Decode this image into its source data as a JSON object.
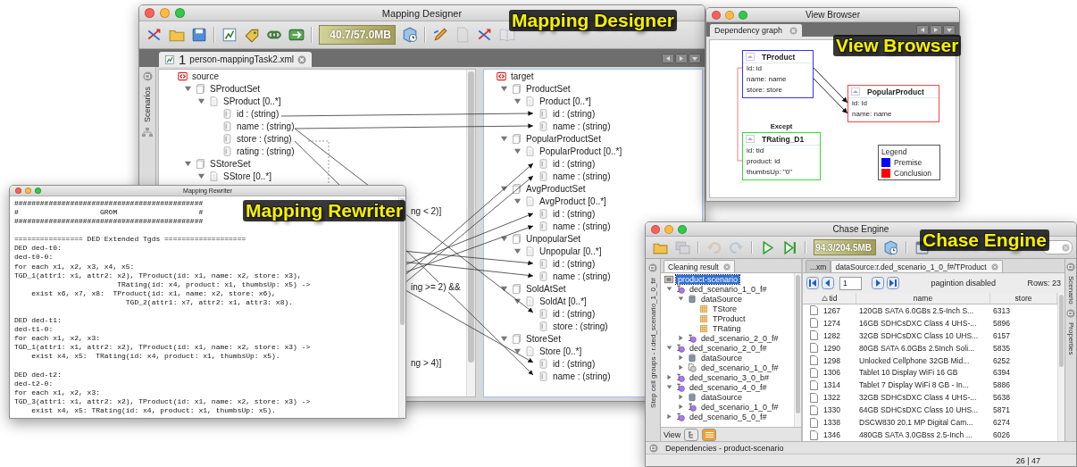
{
  "mapping_designer": {
    "title": "Mapping Designer",
    "callout": "Mapping Designer",
    "toolbar": [
      {
        "kind": "arrows",
        "disabled": false
      },
      {
        "kind": "folder",
        "disabled": false
      },
      {
        "kind": "disk",
        "disabled": false
      },
      {
        "kind": "separator"
      },
      {
        "kind": "chart",
        "disabled": false
      },
      {
        "kind": "tag",
        "disabled": false
      },
      {
        "kind": "chain",
        "disabled": false
      },
      {
        "kind": "refresh",
        "disabled": false
      },
      {
        "kind": "separator"
      },
      {
        "kind": "memory",
        "text": "40.7/57.0MB"
      },
      {
        "kind": "gc",
        "disabled": false
      },
      {
        "kind": "separator"
      },
      {
        "kind": "pencil",
        "disabled": false
      },
      {
        "kind": "page",
        "disabled": true
      },
      {
        "kind": "arrows",
        "disabled": false
      },
      {
        "kind": "book",
        "disabled": true
      }
    ],
    "tab": {
      "number": "1",
      "label": "person-mappingTask2.xml"
    },
    "side_tab": "Scenarios",
    "source_tree": [
      {
        "label": "source",
        "kind": "root",
        "children": [
          {
            "label": "SProductSet",
            "kind": "set",
            "expanded": true,
            "children": [
              {
                "label": "SProduct [0..*]",
                "kind": "element",
                "expanded": true,
                "children": [
                  {
                    "label": "id : (string)",
                    "kind": "attribute"
                  },
                  {
                    "label": "name : (string)",
                    "kind": "attribute"
                  },
                  {
                    "label": "store : (string)",
                    "kind": "attribute"
                  },
                  {
                    "label": "rating : (string)",
                    "kind": "attribute"
                  }
                ]
              }
            ]
          },
          {
            "label": "SStoreSet",
            "kind": "set",
            "expanded": true,
            "children": [
              {
                "label": "SStore [0..*]",
                "kind": "element",
                "expanded": true
              }
            ]
          }
        ]
      }
    ],
    "conditions": [
      "ng < 2)]",
      "ing >= 2) &&",
      "ng > 4)]"
    ],
    "target_tree": [
      {
        "label": "target",
        "kind": "root",
        "children": [
          {
            "label": "ProductSet",
            "kind": "set",
            "expanded": true,
            "children": [
              {
                "label": "Product [0..*]",
                "kind": "element",
                "expanded": true,
                "children": [
                  {
                    "label": "id : (string)",
                    "kind": "attribute"
                  },
                  {
                    "label": "name : (string)",
                    "kind": "attribute"
                  }
                ]
              }
            ]
          },
          {
            "label": "PopularProductSet",
            "kind": "set",
            "expanded": true,
            "children": [
              {
                "label": "PopularProduct [0..*]",
                "kind": "element",
                "expanded": true,
                "children": [
                  {
                    "label": "id : (string)",
                    "kind": "attribute"
                  },
                  {
                    "label": "name : (string)",
                    "kind": "attribute"
                  }
                ]
              }
            ]
          },
          {
            "label": "AvgProductSet",
            "kind": "set",
            "expanded": true,
            "children": [
              {
                "label": "AvgProduct [0..*]",
                "kind": "element",
                "expanded": true,
                "children": [
                  {
                    "label": "id : (string)",
                    "kind": "attribute"
                  },
                  {
                    "label": "name : (string)",
                    "kind": "attribute"
                  }
                ]
              }
            ]
          },
          {
            "label": "UnpopularSet",
            "kind": "set",
            "expanded": true,
            "children": [
              {
                "label": "Unpopular [0..*]",
                "kind": "element",
                "expanded": true,
                "children": [
                  {
                    "label": "id : (string)",
                    "kind": "attribute"
                  },
                  {
                    "label": "name : (string)",
                    "kind": "attribute"
                  }
                ]
              }
            ]
          },
          {
            "label": "SoldAtSet",
            "kind": "set",
            "expanded": true,
            "children": [
              {
                "label": "SoldAt [0..*]",
                "kind": "element",
                "expanded": true,
                "children": [
                  {
                    "label": "id : (string)",
                    "kind": "attribute"
                  },
                  {
                    "label": "store : (string)",
                    "kind": "attribute"
                  }
                ]
              }
            ]
          },
          {
            "label": "StoreSet",
            "kind": "set",
            "expanded": true,
            "children": [
              {
                "label": "Store [0..*]",
                "kind": "element",
                "expanded": true,
                "children": [
                  {
                    "label": "id : (string)",
                    "kind": "attribute"
                  },
                  {
                    "label": "name : (string)",
                    "kind": "attribute"
                  }
                ]
              }
            ]
          }
        ]
      }
    ]
  },
  "view_browser": {
    "title": "View Browser",
    "callout": "View Browser",
    "tab": "Dependency graph",
    "nodes": [
      {
        "title": "TProduct",
        "color": "#3333ff",
        "fields": [
          "id: id",
          "name: name",
          "store: store"
        ]
      },
      {
        "title": "PopularProduct",
        "color": "#ff4444",
        "fields": [
          "id: id",
          "name: name"
        ]
      },
      {
        "title": "TRating_D1",
        "color": "#33dd33",
        "caption": "Except",
        "fields": [
          "id: tid",
          "product: id",
          "thumbsUp: \"0\""
        ]
      }
    ],
    "legend": {
      "title": "Legend",
      "items": [
        {
          "label": "Premise",
          "color": "#0000ff"
        },
        {
          "label": "Conclusion",
          "color": "#ff0000"
        }
      ]
    }
  },
  "mapping_rewriter": {
    "title": "Mapping Rewriter",
    "callout": "Mapping Rewriter",
    "blocks": [
      [
        "############################################",
        "#                   GROM                   #",
        "############################################"
      ],
      [
        "================ DED Extended Tgds ===================",
        "DED ded-t0:",
        "ded-t0-0:",
        "for each x1, x2, x3, x4, x5:",
        "TGD_1(attr1: x1, attr2: x2), TProduct(id: x1, name: x2, store: x3),",
        "                        TRating(id: x4, product: x1, thumbsUp: x5) ->",
        "    exist x6, x7, x8:  TProduct(id: x1, name: x2, store: x6),",
        "                          TGD_2(attr1: x7, attr2: x1, attr3: x8)."
      ],
      [
        "DED ded-t1:",
        "ded-t1-0:",
        "for each x1, x2, x3:",
        "TGD_1(attr1: x1, attr2: x2), TProduct(id: x1, name: x2, store: x3) ->",
        "    exist x4, x5:  TRating(id: x4, product: x1, thumbsUp: x5)."
      ],
      [
        "DED ded-t2:",
        "ded-t2-0:",
        "for each x1, x2, x3:",
        "TGD_3(attr1: x1, attr2: x2), TProduct(id: x1, name: x2, store: x3) ->",
        "    exist x4, x5: TRating(id: x4, product: x1, thumbsUp: x5)."
      ]
    ]
  },
  "chase_engine": {
    "title": "Chase Engine",
    "callout": "Chase Engine",
    "toolbar": [
      {
        "kind": "folder",
        "disabled": false
      },
      {
        "kind": "copy",
        "disabled": true
      },
      {
        "kind": "separator"
      },
      {
        "kind": "undo",
        "disabled": true
      },
      {
        "kind": "redo",
        "disabled": true
      },
      {
        "kind": "separator"
      },
      {
        "kind": "play",
        "disabled": false
      },
      {
        "kind": "step",
        "disabled": false
      },
      {
        "kind": "separator"
      },
      {
        "kind": "memory",
        "text": "94.3/204.5MB"
      },
      {
        "kind": "gc",
        "disabled": false
      },
      {
        "kind": "separator"
      },
      {
        "kind": "printer",
        "disabled": false
      }
    ],
    "side_tab": "Step cell groups - r.ded_scenario_1_0_f#",
    "panel_tab": "Cleaning result",
    "tree": [
      {
        "label": "product-scenario",
        "kind": "project",
        "selected": true,
        "children": [
          {
            "label": "ded_scenario_1_0_f#",
            "kind": "scenario",
            "expanded": true,
            "selected": false,
            "children": [
              {
                "label": "dataSource",
                "kind": "datasource",
                "expanded": true,
                "selected": false,
                "children": [
                  {
                    "label": "TStore",
                    "kind": "table",
                    "selected": false
                  },
                  {
                    "label": "TProduct",
                    "kind": "table",
                    "selected": false
                  },
                  {
                    "label": "TRating",
                    "kind": "table",
                    "selected": false
                  }
                ]
              },
              {
                "label": "ded_scenario_2_0_f#",
                "kind": "scenario",
                "expanded": false,
                "selected": false
              }
            ]
          },
          {
            "label": "ded_scenario_2_0_f#",
            "kind": "scenario",
            "expanded": true,
            "selected": false,
            "children": [
              {
                "label": "dataSource",
                "kind": "datasource",
                "expanded": false,
                "selected": false
              },
              {
                "label": "ded_scenario_1_0_f#",
                "kind": "scenario-link",
                "expanded": false,
                "selected": false
              }
            ]
          },
          {
            "label": "ded_scenario_3_0_b#",
            "kind": "scenario",
            "expanded": false,
            "selected": false
          },
          {
            "label": "ded_scenario_4_0_f#",
            "kind": "scenario",
            "expanded": true,
            "selected": false,
            "children": [
              {
                "label": "dataSource",
                "kind": "datasource",
                "expanded": false,
                "selected": false
              },
              {
                "label": "ded_scenario_1_0_f#",
                "kind": "scenario",
                "expanded": false,
                "selected": false
              }
            ]
          },
          {
            "label": "ded_scenario_5_0_f#",
            "kind": "scenario",
            "expanded": false,
            "selected": false
          }
        ]
      }
    ],
    "view_label": "View",
    "view_modes": [
      {
        "kind": "tree",
        "selected": false
      },
      {
        "kind": "list",
        "selected": true
      }
    ],
    "tabs": [
      {
        "label": "...xm",
        "selected": false
      },
      {
        "label": "dataSource:r.ded_scenario_1_0_f#/TProduct",
        "selected": true
      }
    ],
    "page": "1",
    "pagination": "pagintion disabled",
    "rows_count": "Rows: 23",
    "table": {
      "columns": [
        "tid",
        "name",
        "store"
      ],
      "rows": [
        [
          "1267",
          "120GB SATA 6.0GBs 2.5-Inch S...",
          "6313"
        ],
        [
          "1274",
          "16GB SDHCsDXC Class 4 UHS-...",
          "5896"
        ],
        [
          "1282",
          "32GB SDHCsDXC Class 10 UHS...",
          "6157"
        ],
        [
          "1290",
          "80GB SATA 6.0GBs 2.5Inch Soli...",
          "5835"
        ],
        [
          "1298",
          "Unlocked Cellphone 32GB Mid...",
          "6252"
        ],
        [
          "1306",
          "Tablet 10 Display WiFi 16 GB",
          "6394"
        ],
        [
          "1314",
          "Tablet 7 Display WiFi 8 GB - In...",
          "5886"
        ],
        [
          "1322",
          "32GB SDHCsDXC Class 4 UHS-...",
          "5638"
        ],
        [
          "1330",
          "64GB SDHCsDXC Class 10 UHS...",
          "5871"
        ],
        [
          "1338",
          "DSCW830 20.1 MP Digital Cam...",
          "6274"
        ],
        [
          "1346",
          "480GB SATA 3.0GBss 2.5-Inch ...",
          "6026"
        ]
      ]
    },
    "right_tabs": [
      "Scenario",
      "Properties"
    ],
    "dependencies": "Dependencies - product-scenario",
    "status": "26 | 47"
  }
}
